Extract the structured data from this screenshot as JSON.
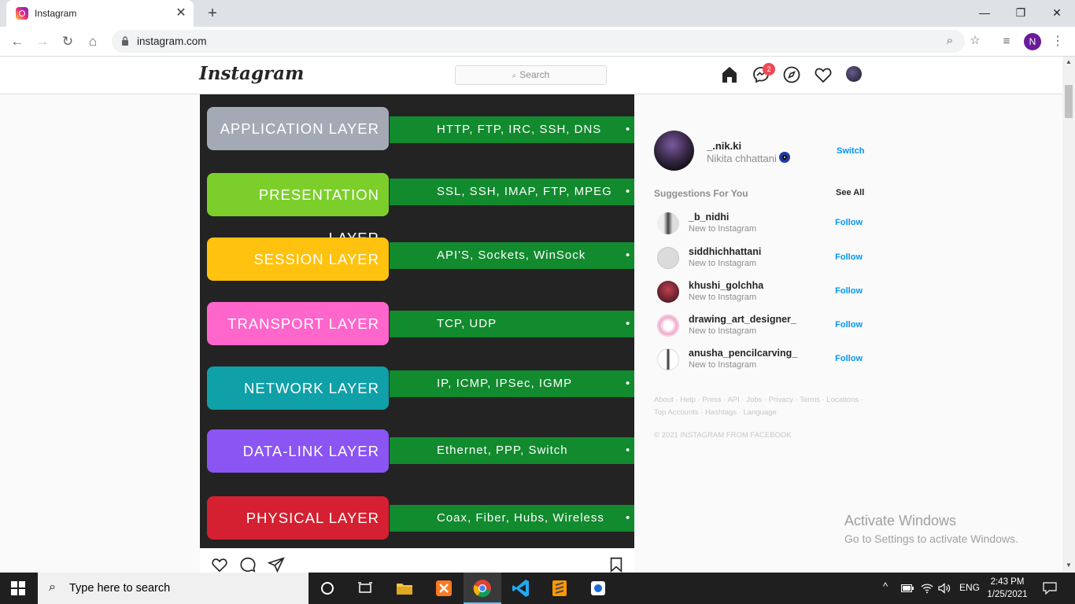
{
  "browser": {
    "tab_title": "Instagram",
    "url": "instagram.com",
    "profile_initial": "N"
  },
  "ig": {
    "logo": "Instagram",
    "search_placeholder": "Search",
    "dm_badge": "2"
  },
  "post": {
    "layers": [
      {
        "name": "APPLICATION LAYER",
        "protocols": "HTTP, FTP, IRC, SSH, DNS",
        "color": "#a3aab5"
      },
      {
        "name": "PRESENTATION LAYER",
        "protocols": "SSL, SSH, IMAP, FTP, MPEG",
        "color": "#7ccf2a"
      },
      {
        "name": "SESSION LAYER",
        "protocols": "API'S, Sockets, WinSock",
        "color": "#ffc20e"
      },
      {
        "name": "TRANSPORT LAYER",
        "protocols": "TCP, UDP",
        "color": "#ff66cc"
      },
      {
        "name": "NETWORK LAYER",
        "protocols": "IP, ICMP, IPSec, IGMP",
        "color": "#10a0a8"
      },
      {
        "name": "DATA-LINK LAYER",
        "protocols": "Ethernet, PPP, Switch",
        "color": "#8a55f2"
      },
      {
        "name": "PHYSICAL LAYER",
        "protocols": "Coax, Fiber, Hubs, Wireless",
        "color": "#d42030"
      }
    ]
  },
  "sidebar": {
    "username": "_.nik.ki",
    "fullname": "Nikita chhattani",
    "switch_label": "Switch",
    "suggestions_title": "Suggestions For You",
    "see_all": "See All",
    "suggestions": [
      {
        "user": "_b_nidhi",
        "sub": "New to Instagram",
        "follow": "Follow"
      },
      {
        "user": "siddhichhattani",
        "sub": "New to Instagram",
        "follow": "Follow"
      },
      {
        "user": "khushi_golchha",
        "sub": "New to Instagram",
        "follow": "Follow"
      },
      {
        "user": "drawing_art_designer_",
        "sub": "New to Instagram",
        "follow": "Follow"
      },
      {
        "user": "anusha_pencilcarving_",
        "sub": "New to Instagram",
        "follow": "Follow"
      }
    ],
    "footer_line1": "About · Help · Press · API · Jobs · Privacy · Terms · Locations ·",
    "footer_line2": "Top Accounts · Hashtags · Language",
    "copyright": "© 2021 INSTAGRAM FROM FACEBOOK"
  },
  "watermark": {
    "line1": "Activate Windows",
    "line2": "Go to Settings to activate Windows."
  },
  "taskbar": {
    "search_placeholder": "Type here to search",
    "language": "ENG",
    "time": "2:43 PM",
    "date": "1/25/2021"
  }
}
